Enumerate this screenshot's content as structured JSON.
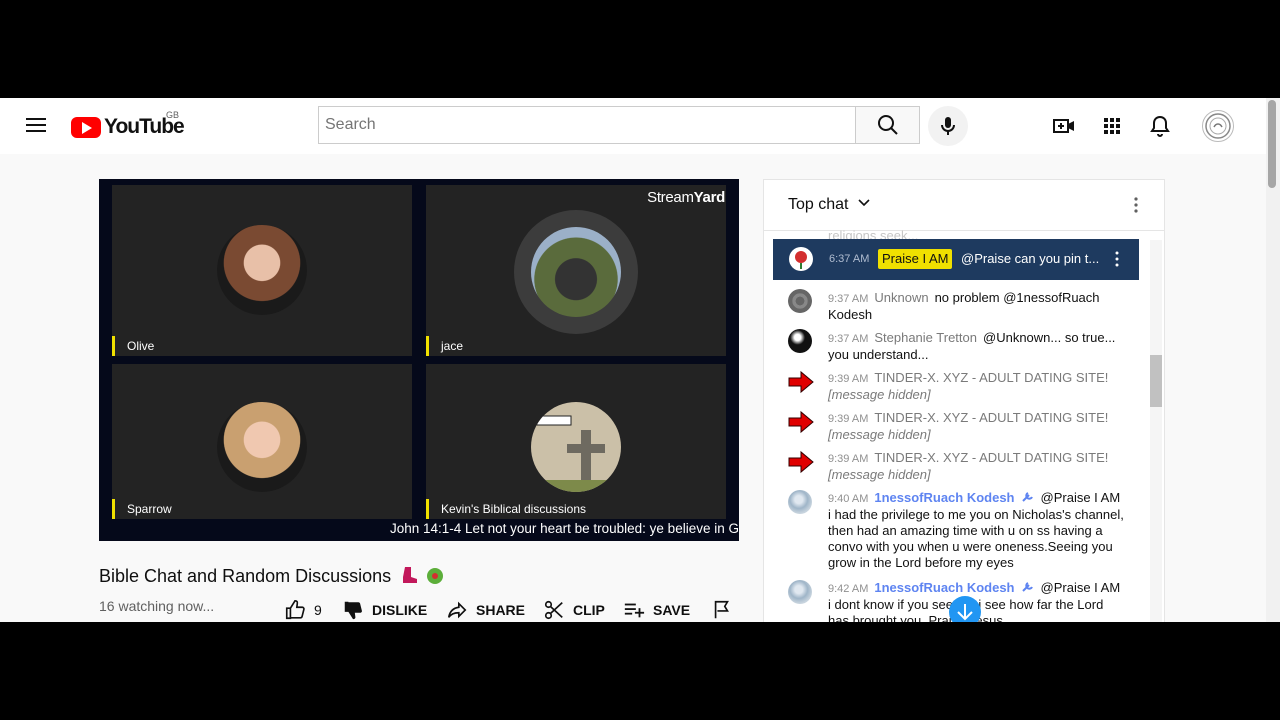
{
  "header": {
    "logo_text": "YouTube",
    "region": "GB",
    "search_placeholder": "Search",
    "search_value": ""
  },
  "player": {
    "brand_prefix": "Stream",
    "brand_suffix": "Yard",
    "participants": [
      {
        "name": "Olive"
      },
      {
        "name": "jace"
      },
      {
        "name": "Sparrow"
      },
      {
        "name": "Kevin's Biblical discussions"
      }
    ],
    "caption": "John 14:1-4 Let not your heart be troubled: ye believe in G"
  },
  "video": {
    "title": "Bible Chat and Random Discussions",
    "watching": "16 watching now...",
    "like_count": "9",
    "dislike_label": "DISLIKE",
    "share_label": "SHARE",
    "clip_label": "CLIP",
    "save_label": "SAVE"
  },
  "chat": {
    "title": "Top chat",
    "faded_text": "religions seek...",
    "pinned": {
      "time": "6:37 AM",
      "author": "Praise I AM",
      "text": "@Praise can you pin t..."
    },
    "messages": [
      {
        "time": "9:37 AM",
        "author": "Unknown",
        "text": "no problem @1nessofRuach Kodesh"
      },
      {
        "time": "9:37 AM",
        "author": "Stephanie Tretton",
        "text": "@Unknown... so true... you understand..."
      },
      {
        "time": "9:39 AM",
        "author": "TINDER-X. XYZ - ADULT DATING SITE!",
        "text": "[message hidden]"
      },
      {
        "time": "9:39 AM",
        "author": "TINDER-X. XYZ - ADULT DATING SITE!",
        "text": "[message hidden]"
      },
      {
        "time": "9:39 AM",
        "author": "TINDER-X. XYZ - ADULT DATING SITE!",
        "text": "[message hidden]"
      },
      {
        "time": "9:40 AM",
        "author": "1nessofRuach Kodesh",
        "text": "@Praise I AM i had the privilege to me you on Nicholas's channel, then had an amazing time with u on ss having a convo with you when u were oneness.Seeing you grow in the Lord before my eyes"
      },
      {
        "time": "9:42 AM",
        "author": "1nessofRuach Kodesh",
        "text": "@Praise I AM i dont know if you see but i see how far the Lord has brought you. Praise Jesus"
      }
    ]
  },
  "colors": {
    "brand_red": "#ff0000",
    "pinned_bg": "#1e3a5f",
    "highlight": "#f0e000",
    "moderator": "#5e84f1"
  }
}
